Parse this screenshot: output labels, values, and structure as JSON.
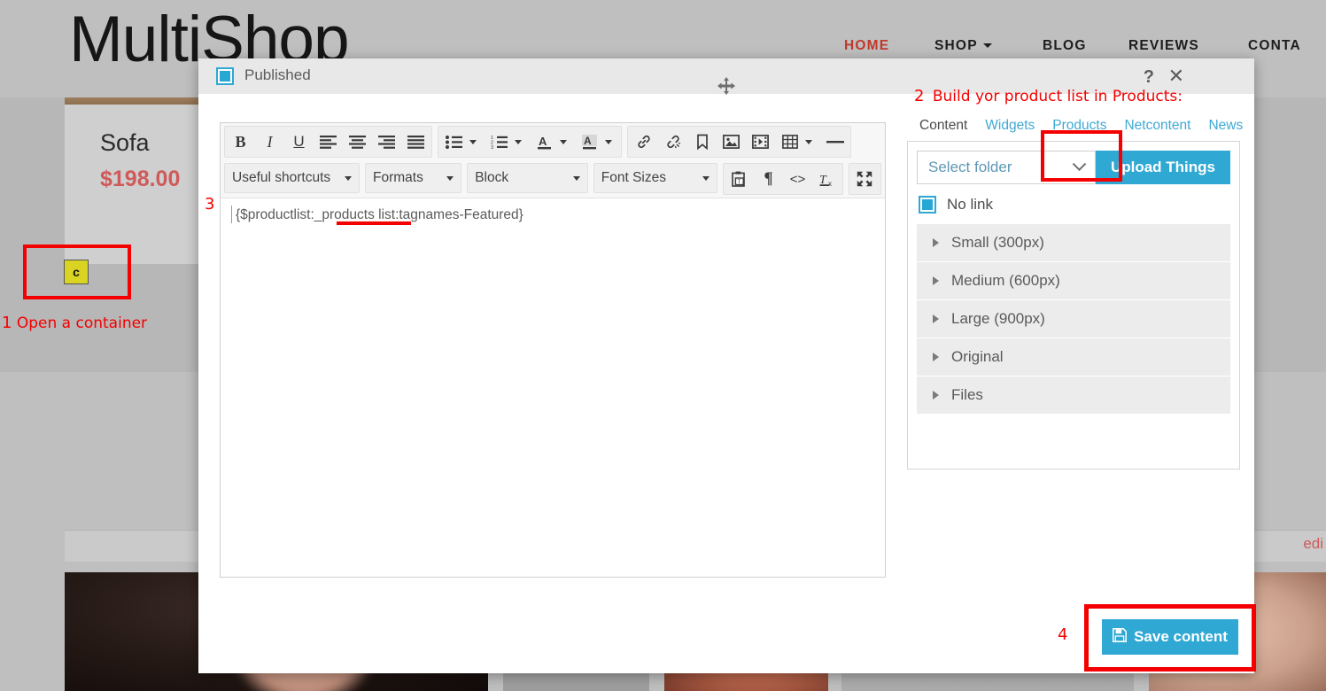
{
  "background": {
    "logo": "MultiShop",
    "nav": [
      {
        "label": "HOME",
        "active": true,
        "dropdown": false
      },
      {
        "label": "SHOP",
        "active": false,
        "dropdown": true
      },
      {
        "label": "BLOG",
        "active": false,
        "dropdown": false
      },
      {
        "label": "REVIEWS",
        "active": false,
        "dropdown": false
      },
      {
        "label": "CONTA",
        "active": false,
        "dropdown": false
      }
    ],
    "product_card": {
      "title": "Sofa",
      "price": "$198.00"
    },
    "container_chip": "c",
    "edit_link": "edi"
  },
  "annotations": {
    "step1": {
      "num": "1",
      "text": "Open a container"
    },
    "step2": {
      "num": "2",
      "text": "Build yor product list in Products:"
    },
    "step3": {
      "num": "3"
    },
    "step4": {
      "num": "4"
    }
  },
  "modal": {
    "status_label": "Published",
    "help_icon": "?",
    "close_icon": "✕",
    "move_icon": "move-handle-icon"
  },
  "editor": {
    "toolbar_row1": [
      {
        "name": "bold",
        "glyph": "B"
      },
      {
        "name": "italic",
        "glyph": "I"
      },
      {
        "name": "underline",
        "glyph": "U"
      },
      {
        "name": "align-left",
        "glyph": "align-left-icon"
      },
      {
        "name": "align-center",
        "glyph": "align-center-icon"
      },
      {
        "name": "align-right",
        "glyph": "align-right-icon"
      },
      {
        "name": "align-justify",
        "glyph": "align-justify-icon"
      },
      {
        "name": "bullet-list",
        "glyph": "bullet-list-icon"
      },
      {
        "name": "numbered-list",
        "glyph": "numbered-list-icon"
      },
      {
        "name": "text-color",
        "glyph": "A"
      },
      {
        "name": "background-color",
        "glyph": "A"
      },
      {
        "name": "insert-link",
        "glyph": "link-icon"
      },
      {
        "name": "unlink",
        "glyph": "unlink-icon"
      },
      {
        "name": "anchor",
        "glyph": "bookmark-icon"
      },
      {
        "name": "insert-image",
        "glyph": "image-icon"
      },
      {
        "name": "insert-media",
        "glyph": "media-icon"
      },
      {
        "name": "insert-table",
        "glyph": "table-icon"
      },
      {
        "name": "horizontal-rule",
        "glyph": "horizontal-rule-icon"
      }
    ],
    "dropdowns": {
      "useful_shortcuts": "Useful shortcuts",
      "formats": "Formats",
      "block": "Block",
      "font_sizes": "Font Sizes"
    },
    "toolbar_row2_icons": [
      {
        "name": "paste-as-text",
        "glyph": "paste-text-icon"
      },
      {
        "name": "show-invisible-characters",
        "glyph": "¶"
      },
      {
        "name": "source-code",
        "glyph": "<>"
      },
      {
        "name": "clear-formatting",
        "glyph": "clear-format-icon"
      },
      {
        "name": "fullscreen",
        "glyph": "fullscreen-icon"
      }
    ],
    "content": "{$productlist:_products list:tagnames-Featured}"
  },
  "right_panel": {
    "tabs": [
      {
        "label": "Content",
        "active": true,
        "highlighted": false
      },
      {
        "label": "Widgets",
        "active": false,
        "highlighted": false
      },
      {
        "label": "Products",
        "active": false,
        "highlighted": true
      },
      {
        "label": "Netcontent",
        "active": false,
        "highlighted": false
      },
      {
        "label": "News",
        "active": false,
        "highlighted": false
      }
    ],
    "folder_select": "Select folder",
    "upload_button": "Upload Things",
    "no_link_label": "No link",
    "accordion": [
      {
        "label": "Small (300px)"
      },
      {
        "label": "Medium (600px)"
      },
      {
        "label": "Large (900px)"
      },
      {
        "label": "Original"
      },
      {
        "label": "Files"
      }
    ]
  },
  "footer": {
    "save_button": "Save content",
    "save_icon": "floppy-disk-icon"
  },
  "colors": {
    "accent": "#2fa8d3",
    "annotation_red": "#f50000",
    "price_red": "#cf5a5a",
    "nav_active": "#c0392b"
  }
}
